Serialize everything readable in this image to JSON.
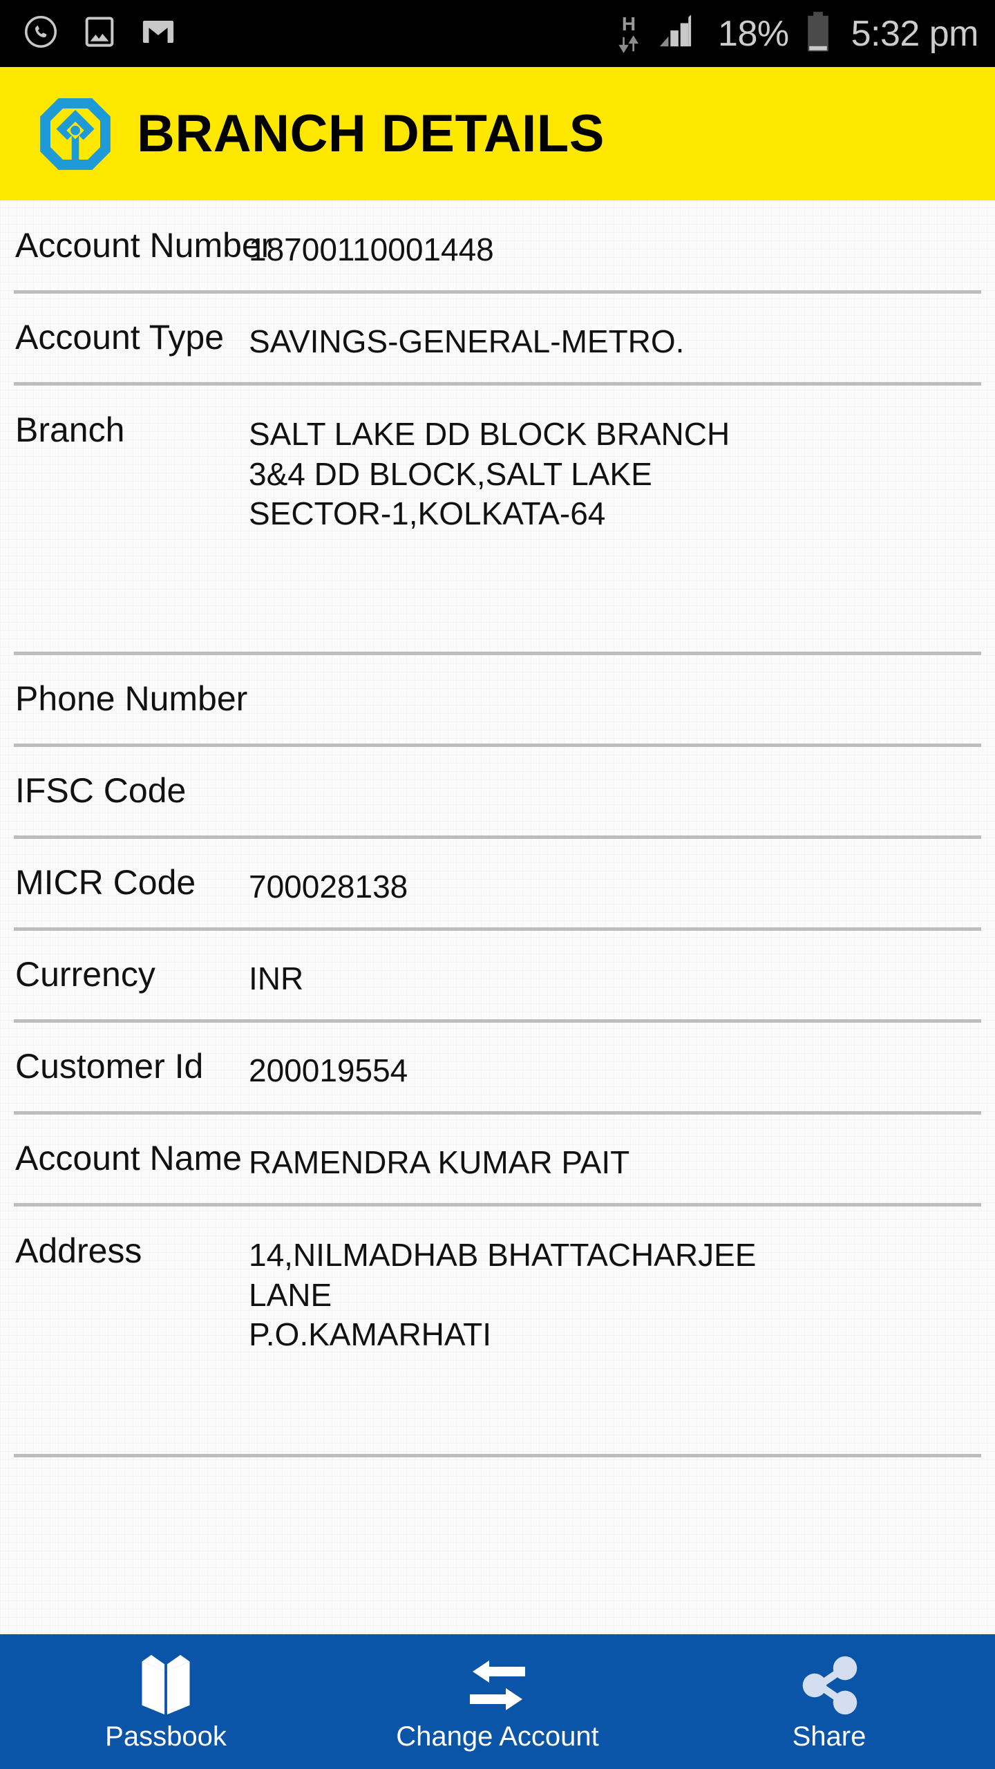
{
  "status_bar": {
    "notification_icons": [
      "whatsapp-icon",
      "gallery-image-icon",
      "gmail-icon"
    ],
    "data_network_letter": "H",
    "data_network_arrows": "up-down-arrows-icon",
    "signal_icon": "signal-bars-icon",
    "battery_percent": "18%",
    "battery_icon": "battery-low-icon",
    "clock": "5:32 pm"
  },
  "header": {
    "logo_name": "bank-of-india-logo",
    "title": "BRANCH DETAILS",
    "background_color": "#FFE800",
    "logo_color": "#1E9BD7"
  },
  "details": {
    "rows": [
      {
        "label": "Account Number",
        "value": "18700110001448"
      },
      {
        "label": "Account Type",
        "value": "SAVINGS-GENERAL-METRO."
      },
      {
        "label": "Branch",
        "value": "SALT LAKE DD BLOCK BRANCH\n3&4 DD BLOCK,SALT LAKE\nSECTOR-1,KOLKATA-64"
      },
      {
        "label": "Phone Number",
        "value": ""
      },
      {
        "label": "IFSC Code",
        "value": ""
      },
      {
        "label": "MICR Code",
        "value": "700028138"
      },
      {
        "label": "Currency",
        "value": "INR"
      },
      {
        "label": "Customer Id",
        "value": "200019554"
      },
      {
        "label": "Account Name",
        "value": "RAMENDRA KUMAR PAIT"
      },
      {
        "label": "Address",
        "value": "14,NILMADHAB BHATTACHARJEE\nLANE\nP.O.KAMARHATI"
      }
    ]
  },
  "bottom_nav": {
    "background_color": "#0B55A8",
    "items": [
      {
        "label": "Passbook",
        "icon": "open-book-icon"
      },
      {
        "label": "Change Account",
        "icon": "exchange-arrows-icon"
      },
      {
        "label": "Share",
        "icon": "share-nodes-icon"
      }
    ]
  }
}
